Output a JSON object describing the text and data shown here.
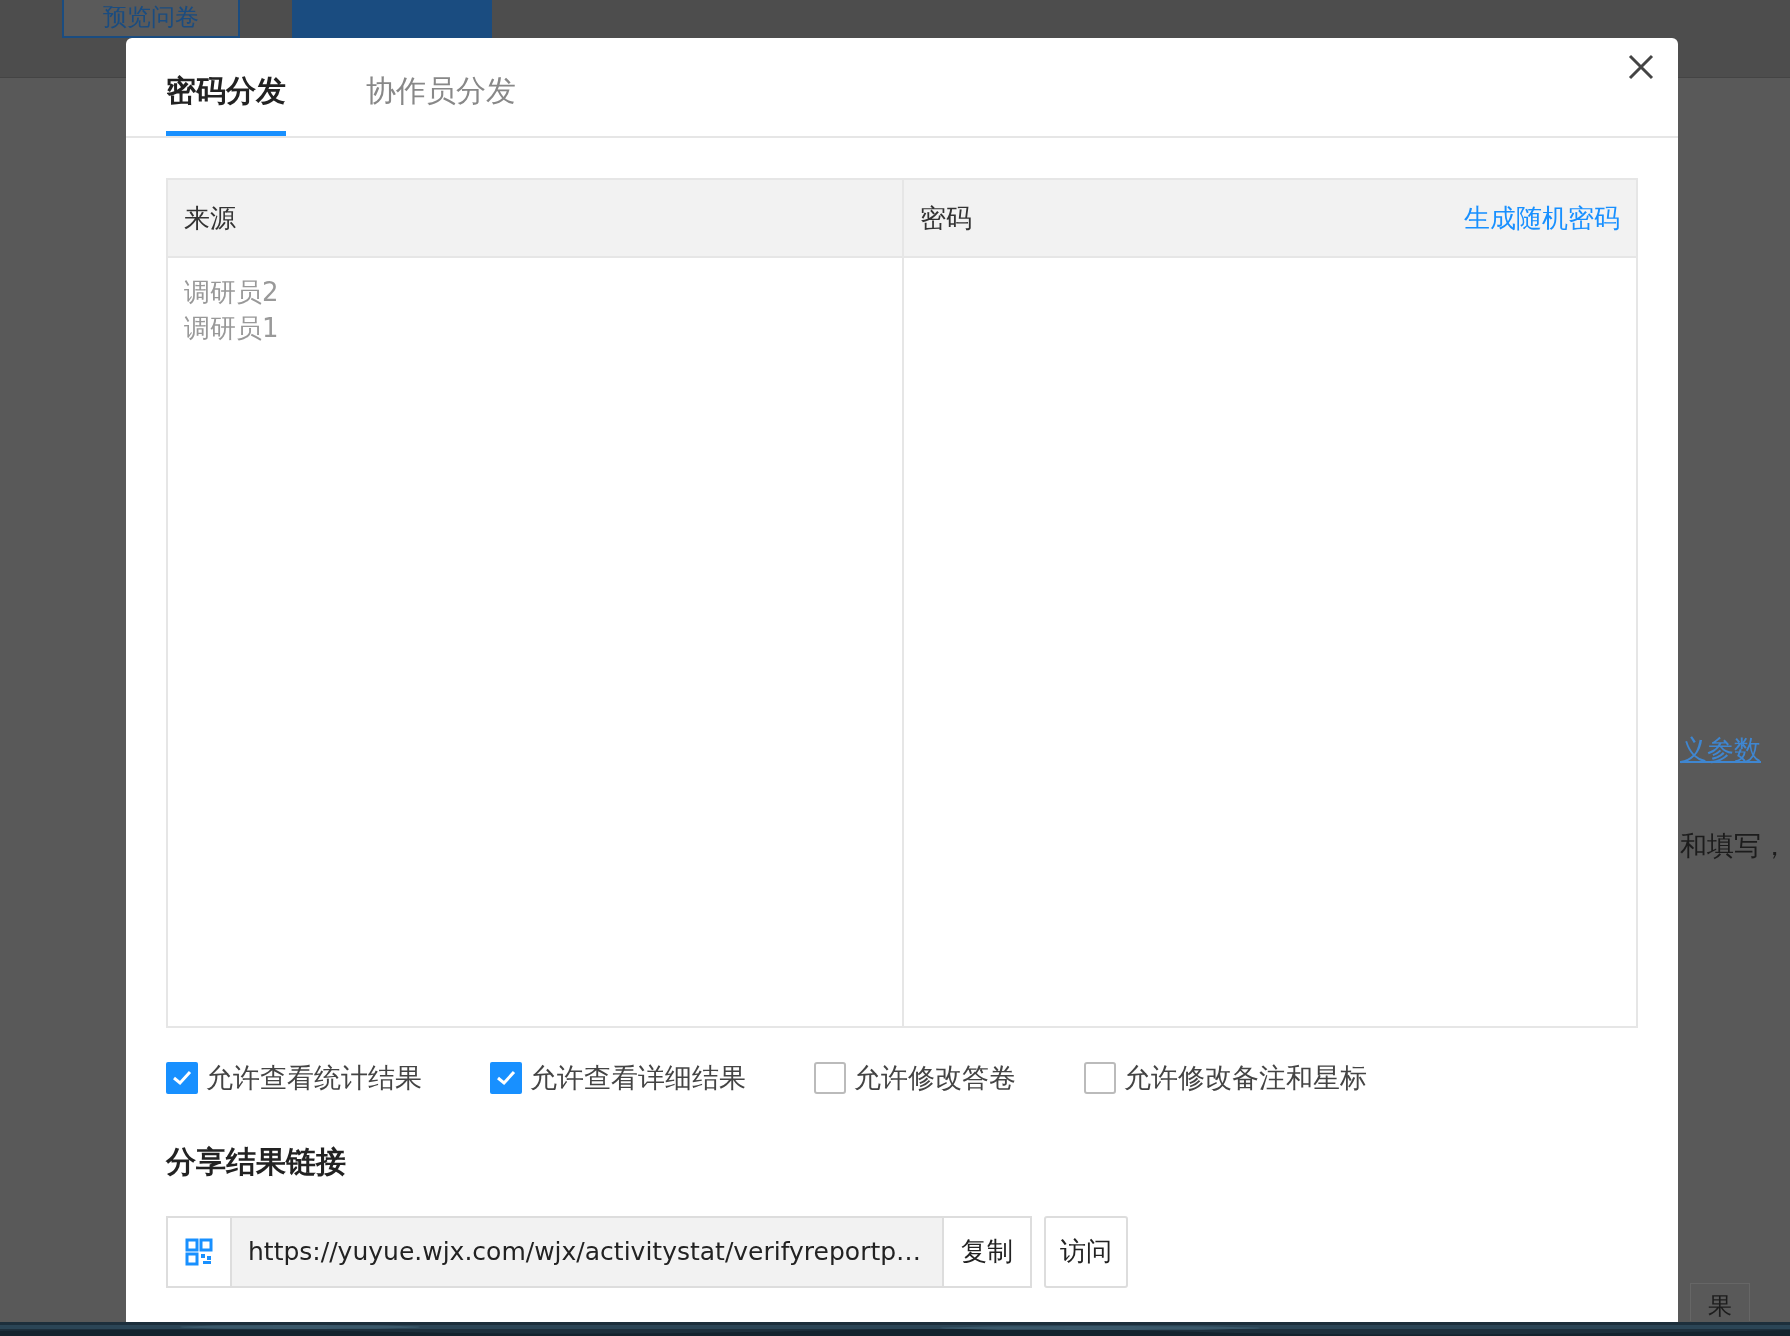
{
  "background": {
    "preview_button": "预览问卷",
    "param_link": "义参数",
    "body_text": "和填写，",
    "bottom_button": "果"
  },
  "dialog": {
    "tabs": [
      {
        "label": "密码分发",
        "selected": true
      },
      {
        "label": "协作员分发",
        "selected": false
      }
    ],
    "table": {
      "columns": [
        "来源",
        "密码"
      ],
      "action_link": "生成随机密码",
      "sources": [
        "调研员2",
        "调研员1"
      ]
    },
    "options": [
      {
        "label": "允许查看统计结果",
        "checked": true
      },
      {
        "label": "允许查看详细结果",
        "checked": true
      },
      {
        "label": "允许修改答卷",
        "checked": false
      },
      {
        "label": "允许修改备注和星标",
        "checked": false
      }
    ],
    "share_heading": "分享结果链接",
    "share_url": "https://yuyue.wjx.com/wjx/activitystat/verifyreportp…",
    "buttons": [
      "复制",
      "访问"
    ]
  }
}
